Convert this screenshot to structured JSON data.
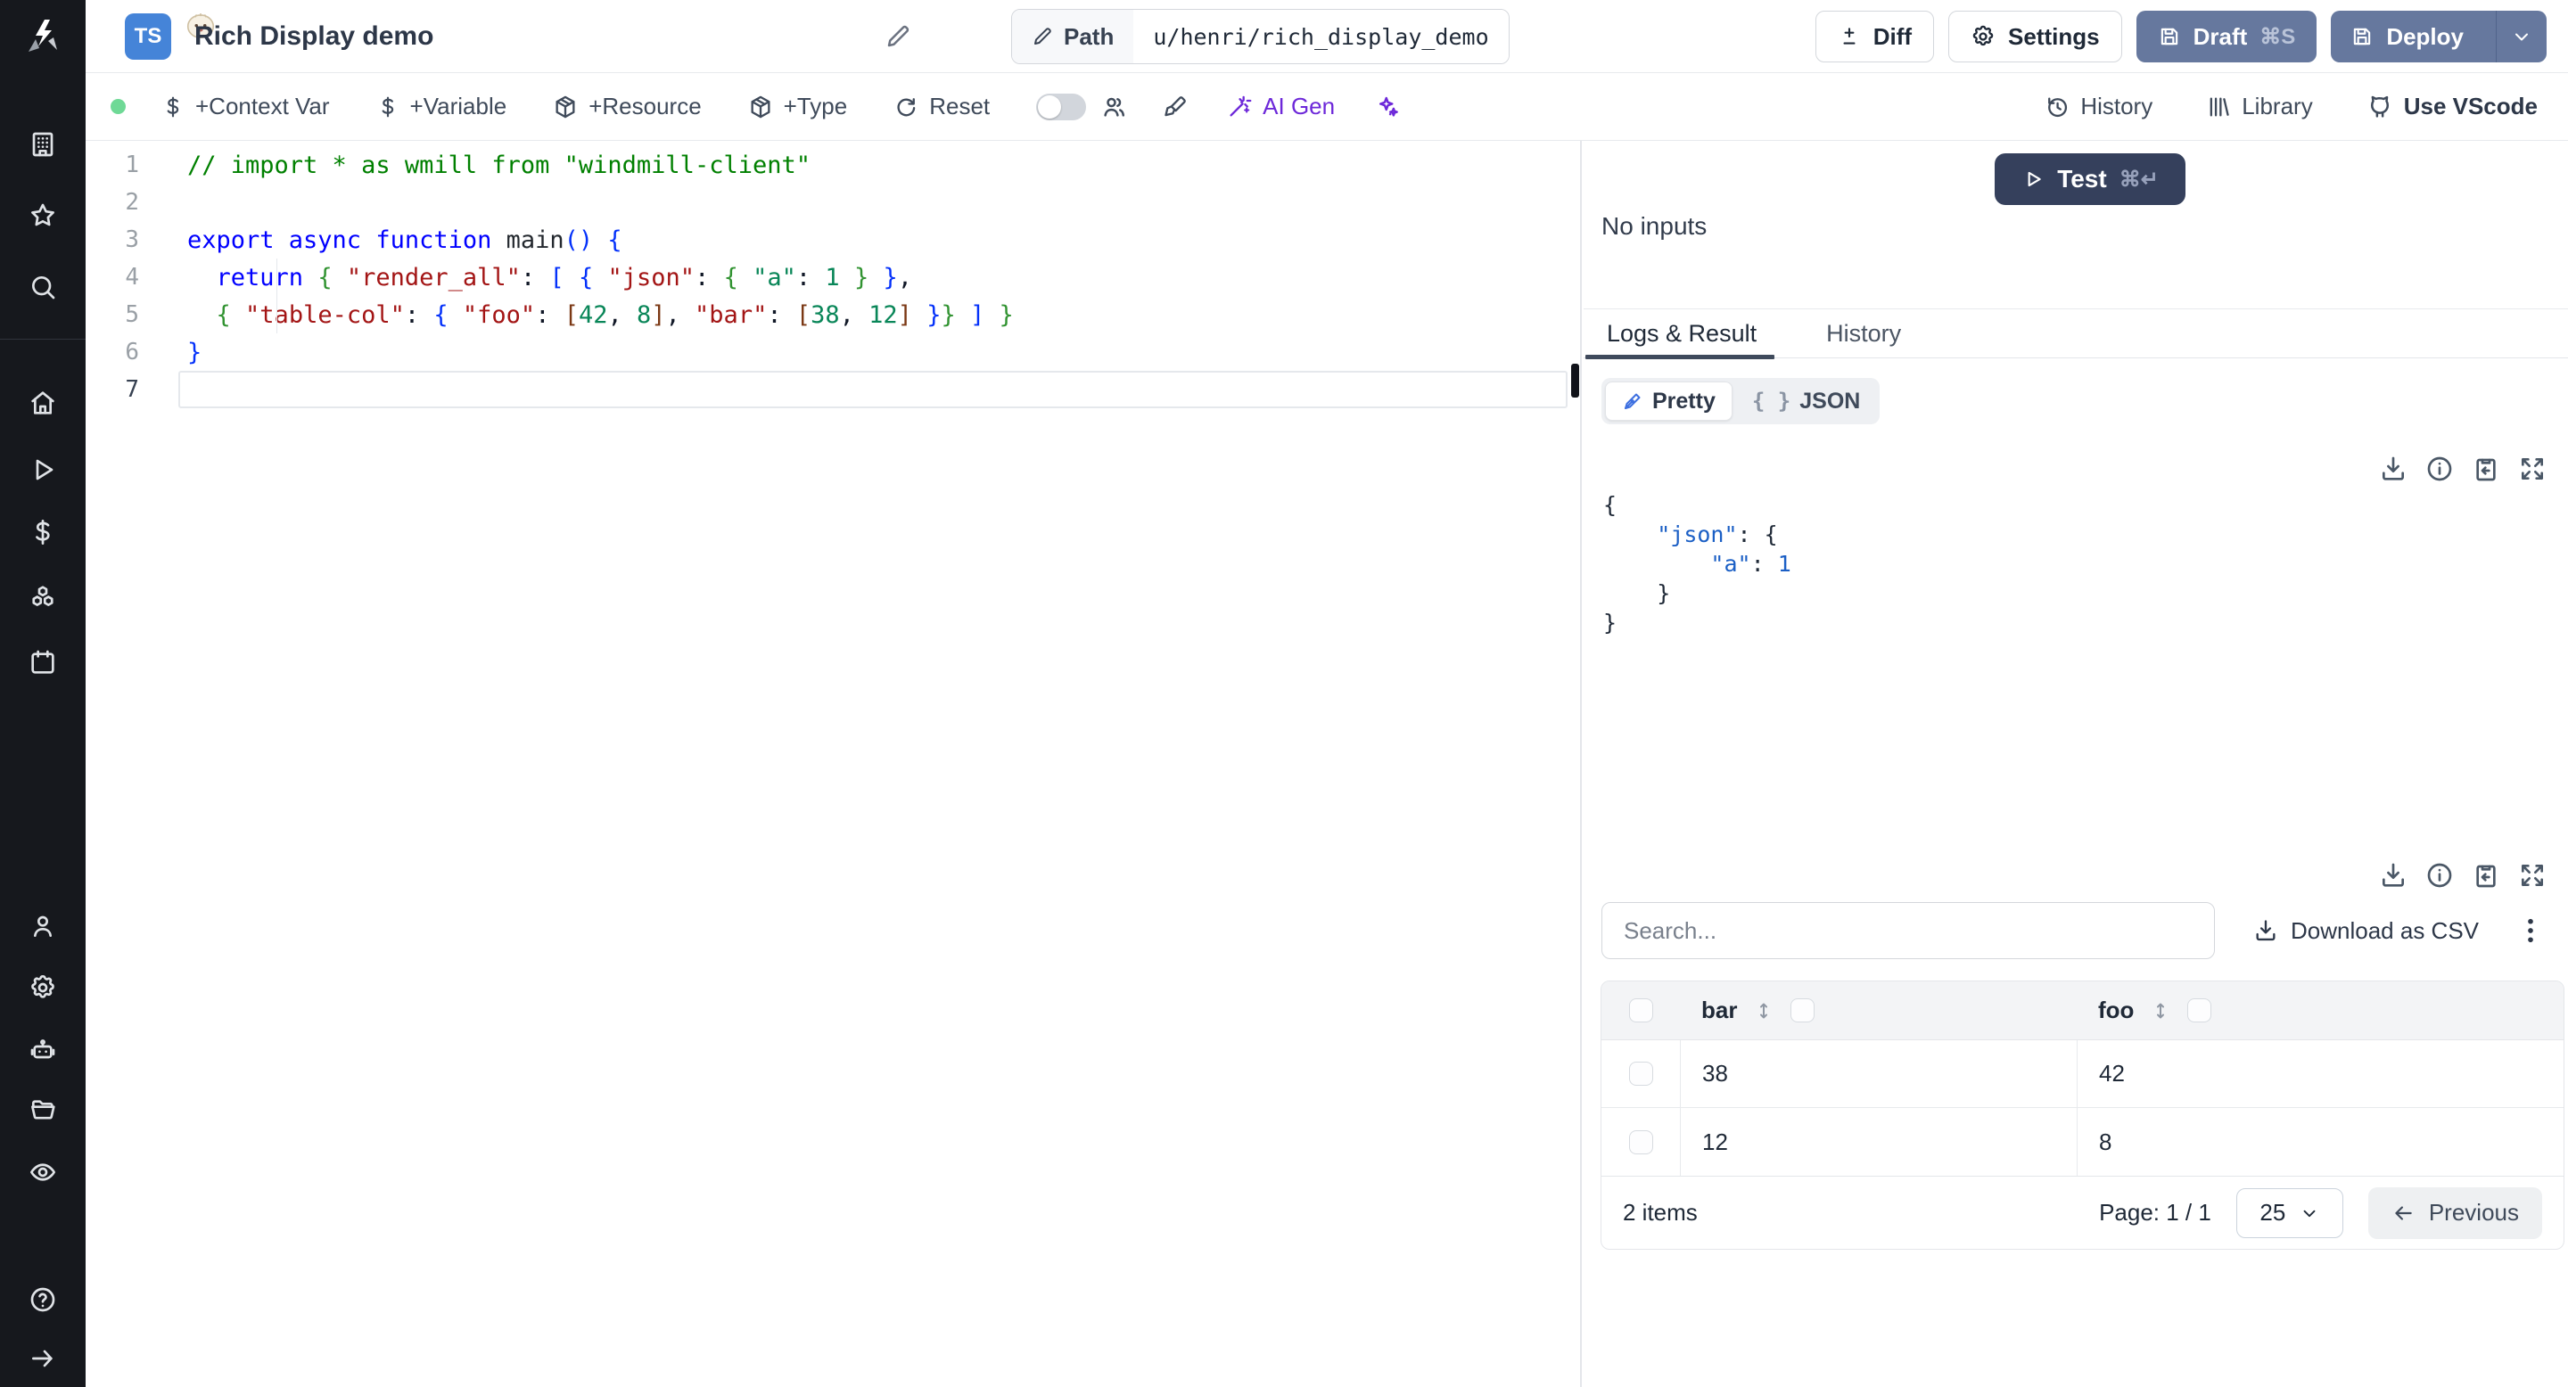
{
  "colors": {
    "sidebar_bg": "#16181d",
    "slate_button": "#66789e",
    "test_button": "#35405c",
    "ts_badge_blue": "#4584d8",
    "ai_purple": "#6d28d9",
    "status_green": "#6fd996",
    "tab_underline": "#3f4a5c",
    "json_blue": "#1b5fc5",
    "code_comment": "#008000",
    "code_keyword": "#0000ff",
    "code_string_key": "#a31515",
    "code_number": "#098658"
  },
  "sidebar": {
    "icons": [
      "windmill-logo",
      "workspace",
      "favorites",
      "search",
      "home",
      "runs",
      "variables",
      "resources",
      "schedules",
      "users",
      "settings",
      "workers",
      "folders",
      "audit-logs",
      "help",
      "expand"
    ]
  },
  "header": {
    "language_badge": "TS",
    "title": "Rich Display demo",
    "path_label": "Path",
    "path_value": "u/henri/rich_display_demo",
    "diff": "Diff",
    "settings": "Settings",
    "draft": "Draft",
    "draft_shortcut": "⌘S",
    "deploy": "Deploy"
  },
  "toolbar": {
    "context_var": "+Context Var",
    "variable": "+Variable",
    "resource": "+Resource",
    "type": "+Type",
    "reset": "Reset",
    "ai_gen": "AI Gen",
    "history": "History",
    "library": "Library",
    "vscode": "Use VScode"
  },
  "editor": {
    "lines": [
      {
        "n": "1",
        "tokens": [
          [
            "// import * as wmill from \"windmill-client\"",
            "cmt"
          ]
        ]
      },
      {
        "n": "2",
        "tokens": []
      },
      {
        "n": "3",
        "tokens": [
          [
            "export async function ",
            "kw"
          ],
          [
            "main",
            "fn"
          ],
          [
            "() {",
            "b1"
          ]
        ]
      },
      {
        "n": "4",
        "tokens": [
          [
            "  ",
            ""
          ],
          [
            "return",
            "kw"
          ],
          [
            " ",
            ""
          ],
          [
            "{",
            "b2"
          ],
          [
            " ",
            ""
          ],
          [
            "\"render_all\"",
            "key"
          ],
          [
            ": ",
            ""
          ],
          [
            "[",
            "b1"
          ],
          [
            " ",
            ""
          ],
          [
            "{",
            "b1"
          ],
          [
            " ",
            ""
          ],
          [
            "\"json\"",
            "key"
          ],
          [
            ": ",
            ""
          ],
          [
            "{",
            "b2"
          ],
          [
            " ",
            ""
          ],
          [
            "\"a\"",
            "num"
          ],
          [
            ": ",
            ""
          ],
          [
            "1",
            "num"
          ],
          [
            " ",
            ""
          ],
          [
            "}",
            "b2"
          ],
          [
            " ",
            ""
          ],
          [
            "}",
            "b1"
          ],
          [
            ",",
            ""
          ]
        ]
      },
      {
        "n": "5",
        "tokens": [
          [
            "  ",
            ""
          ],
          [
            "{",
            "b2"
          ],
          [
            " ",
            ""
          ],
          [
            "\"table-col\"",
            "key"
          ],
          [
            ": ",
            ""
          ],
          [
            "{",
            "b1"
          ],
          [
            " ",
            ""
          ],
          [
            "\"foo\"",
            "key"
          ],
          [
            ": ",
            ""
          ],
          [
            "[",
            "b3"
          ],
          [
            "42",
            "num"
          ],
          [
            ", ",
            ""
          ],
          [
            "8",
            "num"
          ],
          [
            "]",
            "b3"
          ],
          [
            ", ",
            ""
          ],
          [
            "\"bar\"",
            "key"
          ],
          [
            ": ",
            ""
          ],
          [
            "[",
            "b3"
          ],
          [
            "38",
            "num"
          ],
          [
            ", ",
            ""
          ],
          [
            "12",
            "num"
          ],
          [
            "]",
            "b3"
          ],
          [
            " ",
            ""
          ],
          [
            "}",
            "b1"
          ],
          [
            "}",
            "b2"
          ],
          [
            " ",
            ""
          ],
          [
            "]",
            "b1"
          ],
          [
            " ",
            ""
          ],
          [
            "}",
            "b2"
          ]
        ]
      },
      {
        "n": "6",
        "tokens": [
          [
            "}",
            "b1"
          ]
        ]
      },
      {
        "n": "7",
        "tokens": [],
        "active": true
      }
    ]
  },
  "panel": {
    "test_label": "Test",
    "test_shortcut": "⌘↵",
    "no_inputs": "No inputs",
    "tab_logs": "Logs & Result",
    "tab_history": "History",
    "pretty": "Pretty",
    "json_label": "JSON",
    "json_glyph": "{ }",
    "result_lines": [
      [
        [
          "{",
          "jp"
        ]
      ],
      [
        [
          "    ",
          ""
        ],
        [
          "\"json\"",
          "jk"
        ],
        [
          ": ",
          "jp"
        ],
        [
          "{",
          "jp"
        ]
      ],
      [
        [
          "        ",
          ""
        ],
        [
          "\"a\"",
          "jk"
        ],
        [
          ": ",
          "jp"
        ],
        [
          "1",
          "jn"
        ]
      ],
      [
        [
          "    ",
          ""
        ],
        [
          "}",
          "jp"
        ]
      ],
      [
        [
          "}",
          "jp"
        ]
      ]
    ],
    "table": {
      "search_placeholder": "Search...",
      "download_csv": "Download as CSV",
      "columns": [
        "bar",
        "foo"
      ],
      "rows": [
        [
          "38",
          "42"
        ],
        [
          "12",
          "8"
        ]
      ],
      "items_text": "2 items",
      "page_text": "Page: 1 / 1",
      "page_size": "25",
      "previous": "Previous"
    }
  }
}
